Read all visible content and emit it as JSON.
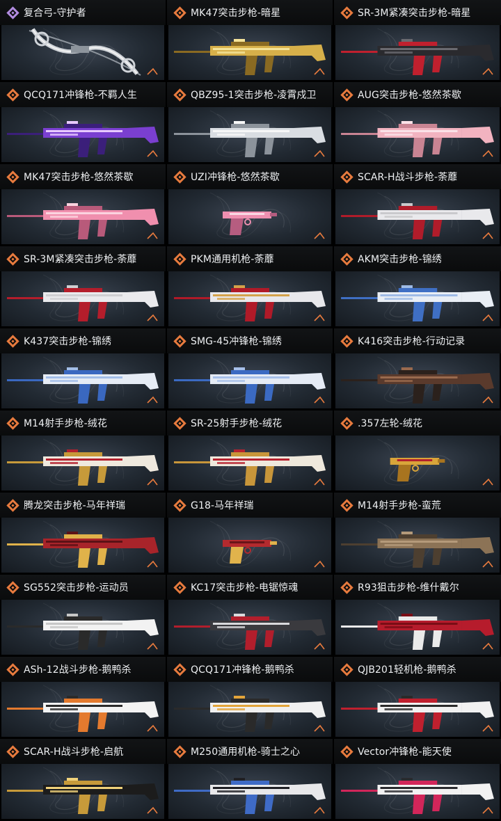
{
  "weapons": [
    {
      "name": "复合弓-守护者",
      "rarity": "purple",
      "colors": [
        "#cfd3d8",
        "#8d949c",
        "#f2f2f2"
      ]
    },
    {
      "name": "MK47突击步枪-暗星",
      "rarity": "orange",
      "colors": [
        "#d7b04a",
        "#8a6a22",
        "#f4e39a"
      ]
    },
    {
      "name": "SR-3M紧凑突击步枪-暗星",
      "rarity": "orange",
      "colors": [
        "#2a2a2e",
        "#c0202e",
        "#6a6a70"
      ]
    },
    {
      "name": "QCQ171冲锋枪-不羁人生",
      "rarity": "orange",
      "colors": [
        "#7a3fd0",
        "#3b1f7a",
        "#e8c9ff"
      ]
    },
    {
      "name": "QBZ95-1突击步枪-凌霄戍卫",
      "rarity": "orange",
      "colors": [
        "#d9dde2",
        "#8c939b",
        "#f7f7f7"
      ]
    },
    {
      "name": "AUG突击步枪-悠然茶歇",
      "rarity": "orange",
      "colors": [
        "#f2b3c0",
        "#c98493",
        "#fbe2e8"
      ]
    },
    {
      "name": "MK47突击步枪-悠然茶歇",
      "rarity": "orange",
      "colors": [
        "#f08fae",
        "#b85a7a",
        "#fbd3df"
      ]
    },
    {
      "name": "UZI冲锋枪-悠然茶歇",
      "rarity": "orange",
      "colors": [
        "#ee8fb0",
        "#b65d80",
        "#fad7e3"
      ]
    },
    {
      "name": "SCAR-H战斗步枪-荼蘼",
      "rarity": "orange",
      "colors": [
        "#e9e9ec",
        "#b01c2a",
        "#c9c9cc"
      ]
    },
    {
      "name": "SR-3M紧凑突击步枪-荼蘼",
      "rarity": "orange",
      "colors": [
        "#eaeaed",
        "#b41d2b",
        "#cfcfd2"
      ]
    },
    {
      "name": "PKM通用机枪-荼蘼",
      "rarity": "orange",
      "colors": [
        "#e8e8eb",
        "#b01a28",
        "#d4a24a"
      ]
    },
    {
      "name": "AKM突击步枪-锦绣",
      "rarity": "orange",
      "colors": [
        "#e9eef5",
        "#3f6fc4",
        "#9fbbe6"
      ]
    },
    {
      "name": "K437突击步枪-锦绣",
      "rarity": "orange",
      "colors": [
        "#e6ecf5",
        "#3a68c0",
        "#a3bee8"
      ]
    },
    {
      "name": "SMG-45冲锋枪-锦绣",
      "rarity": "orange",
      "colors": [
        "#e5ebf5",
        "#3b6ac2",
        "#a7c0ea"
      ]
    },
    {
      "name": "K416突击步枪-行动记录",
      "rarity": "orange",
      "colors": [
        "#5a3a2c",
        "#2b211c",
        "#9a6a4e"
      ]
    },
    {
      "name": "M14射手步枪-绒花",
      "rarity": "orange",
      "colors": [
        "#efe9de",
        "#c79a3a",
        "#b3212e"
      ]
    },
    {
      "name": "SR-25射手步枪-绒花",
      "rarity": "orange",
      "colors": [
        "#eee8dc",
        "#c8963a",
        "#b6222f"
      ]
    },
    {
      "name": ".357左轮-绒花",
      "rarity": "orange",
      "colors": [
        "#d9a53a",
        "#a8741f",
        "#b4212d"
      ]
    },
    {
      "name": "腾龙突击步枪-马年祥瑞",
      "rarity": "orange",
      "colors": [
        "#a8242a",
        "#e0b24a",
        "#5c1216"
      ]
    },
    {
      "name": "G18-马年祥瑞",
      "rarity": "orange",
      "colors": [
        "#b42a2e",
        "#e1b34c",
        "#6a1418"
      ]
    },
    {
      "name": "M14射手步枪-蛮荒",
      "rarity": "orange",
      "colors": [
        "#8c7356",
        "#4d3f30",
        "#b49a7a"
      ]
    },
    {
      "name": "SG552突击步枪-运动员",
      "rarity": "orange",
      "colors": [
        "#f2f2f2",
        "#2a2a2a",
        "#c7c7c7"
      ]
    },
    {
      "name": "KC17突击步枪-电锯惊魂",
      "rarity": "orange",
      "colors": [
        "#3a3a3e",
        "#b21e2c",
        "#d9d9dc"
      ]
    },
    {
      "name": "R93狙击步枪-维什戴尔",
      "rarity": "orange",
      "colors": [
        "#b61c2c",
        "#eaeaea",
        "#7a0d16"
      ]
    },
    {
      "name": "ASh-12战斗步枪-鹅鸭杀",
      "rarity": "orange",
      "colors": [
        "#f3f3f3",
        "#e47a2e",
        "#2b2b2b"
      ]
    },
    {
      "name": "QCQ171冲锋枪-鹅鸭杀",
      "rarity": "orange",
      "colors": [
        "#f0f0f0",
        "#2a2a2a",
        "#e2a43a"
      ]
    },
    {
      "name": "QJB201轻机枪-鹅鸭杀",
      "rarity": "orange",
      "colors": [
        "#f1f1f1",
        "#c0202e",
        "#2a2a2a"
      ]
    },
    {
      "name": "SCAR-H战斗步枪-启航",
      "rarity": "orange",
      "colors": [
        "#1c1c1c",
        "#c79a3a",
        "#f0d27a"
      ]
    },
    {
      "name": "M250通用机枪-骑士之心",
      "rarity": "orange",
      "colors": [
        "#e8e8ea",
        "#3f6bc6",
        "#1f1f24"
      ]
    },
    {
      "name": "Vector冲锋枪-能天使",
      "rarity": "orange",
      "colors": [
        "#f2f2f2",
        "#d2265a",
        "#2a2a2e"
      ]
    }
  ],
  "ui": {
    "accent_orange": "#e87b3e",
    "accent_purple": "#b28ce0",
    "card_bg": "#222a33",
    "title_text": "#eef0f2"
  }
}
